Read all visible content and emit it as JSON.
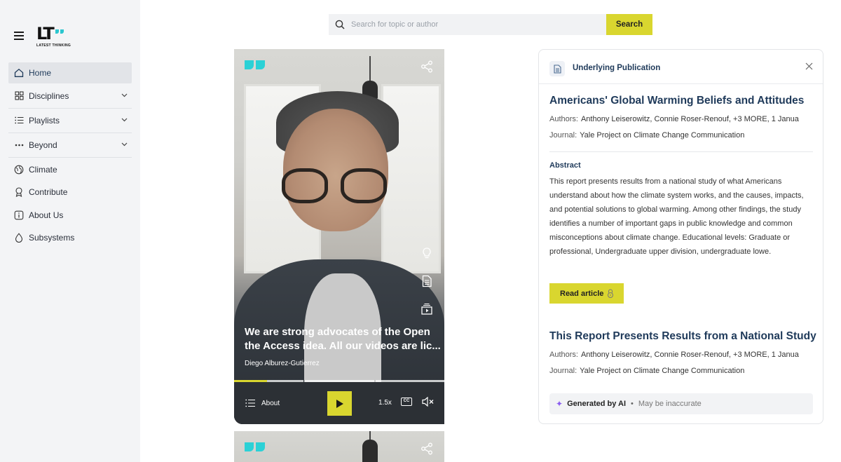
{
  "brand": {
    "logo_text": "LT",
    "logo_sub": "LATEST THINKING"
  },
  "sidebar": {
    "items": [
      {
        "label": "Home",
        "icon": "home-icon",
        "active": true
      },
      {
        "label": "Disciplines",
        "icon": "grid-icon",
        "chevron": true
      },
      {
        "label": "Playlists",
        "icon": "list-icon",
        "chevron": true
      },
      {
        "label": "Beyond",
        "icon": "dots-icon",
        "chevron": true
      },
      {
        "label": "Climate",
        "icon": "globe-icon"
      },
      {
        "label": "Contribute",
        "icon": "award-icon"
      },
      {
        "label": "About Us",
        "icon": "info-icon"
      },
      {
        "label": "Subsystems",
        "icon": "drop-icon"
      }
    ]
  },
  "search": {
    "placeholder": "Search for topic or author",
    "button_label": "Search"
  },
  "video": {
    "caption": "We are strong advocates of the Open the Access idea. All our videos are lic...",
    "author": "Diego Alburez-Gutierrez",
    "about_label": "About",
    "speed": "1.5x",
    "cc_label": "CC",
    "progress_segments": 3,
    "progress_fraction": 0.155,
    "accent": "#d9d62f"
  },
  "panel": {
    "title": "Underlying Publication",
    "publications": [
      {
        "title": "Americans' Global Warming Beliefs and Attitudes",
        "authors_key": "Authors:",
        "authors": "Anthony Leiserowitz, Connie Roser-Renouf, +3 MORE, 1 Janua",
        "journal_key": "Journal:",
        "journal": "Yale Project on Climate Change Communication"
      },
      {
        "title": "This Report Presents Results from a National Study",
        "authors_key": "Authors:",
        "authors": "Anthony Leiserowitz, Connie Roser-Renouf, +3 MORE, 1 Janua",
        "journal_key": "Journal:",
        "journal": "Yale Project on Climate Change Communication"
      }
    ],
    "abstract_heading": "Abstract",
    "abstract": "This report presents results from a national study of what Americans understand about how the climate system works, and the causes, impacts, and potential solutions to global warming. Among other findings, the study identifies a number of important gaps in public knowledge and common misconceptions about climate change. Educational levels: Graduate or professional, Undergraduate upper division, undergraduate lowe.",
    "read_article": "Read article",
    "generated_by": "Generated by AI",
    "dot": "•",
    "disclaimer": "May be inaccurate"
  },
  "colors": {
    "accent": "#d9d62f",
    "brand_teal": "#2bc6cf",
    "heading": "#1f3a5a",
    "sidebar_bg": "#f3f4f6"
  }
}
